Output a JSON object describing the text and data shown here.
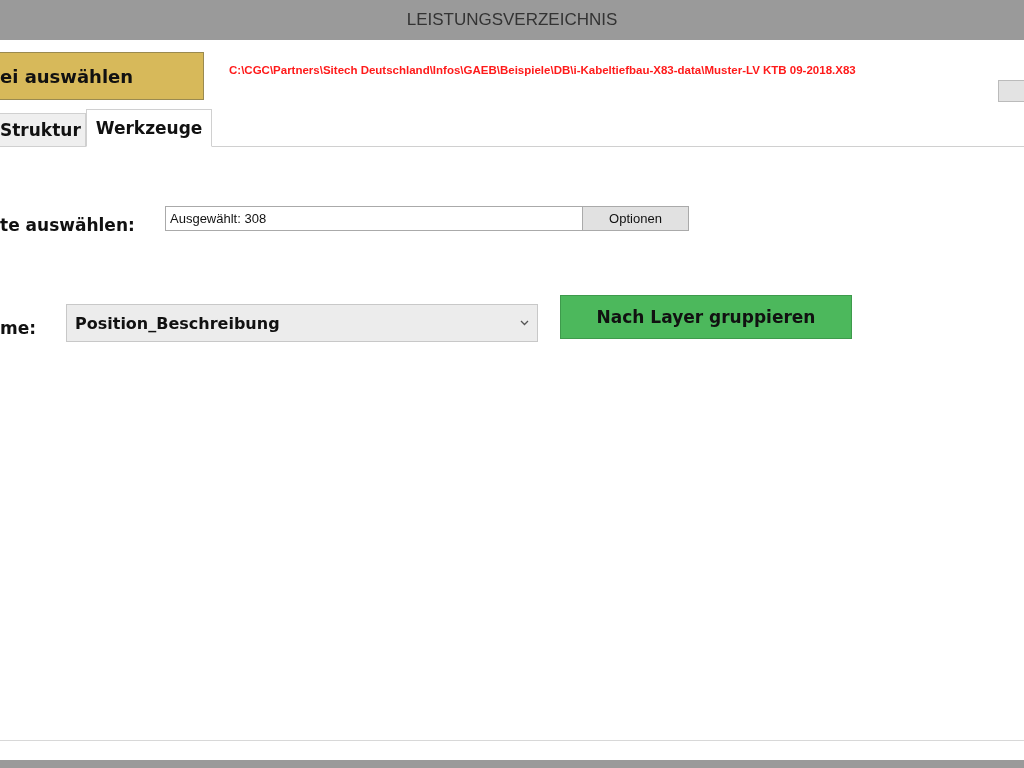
{
  "window": {
    "title": "LEISTUNGSVERZEICHNIS"
  },
  "file_button": {
    "label": "ei auswählen"
  },
  "file_path": "C:\\CGC\\Partners\\Sitech Deutschland\\Infos\\GAEB\\Beispiele\\DB\\i-Kabeltiefbau-X83-data\\Muster-LV KTB 09-2018.X83",
  "tabs": [
    {
      "label": "Struktur",
      "selected": false
    },
    {
      "label": "Werkzeuge",
      "selected": true
    }
  ],
  "selection": {
    "label": "te auswählen:",
    "value": "Ausgewählt: 308",
    "button": "Optionen"
  },
  "name_row": {
    "label": "me:",
    "value": "Position_Beschreibung",
    "button": "Nach Layer gruppieren"
  }
}
